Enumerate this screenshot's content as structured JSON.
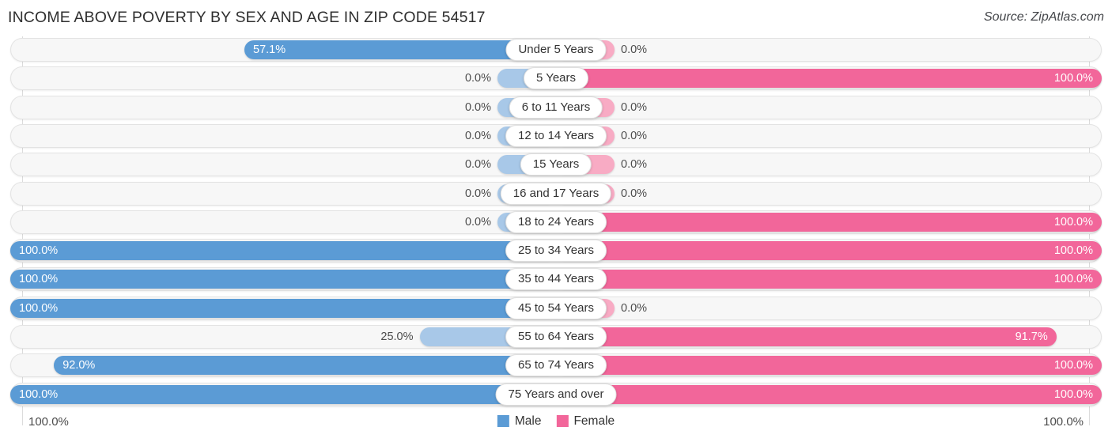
{
  "header": {
    "title": "INCOME ABOVE POVERTY BY SEX AND AGE IN ZIP CODE 54517",
    "source": "Source: ZipAtlas.com"
  },
  "footer": {
    "axis_left": "100.0%",
    "axis_right": "100.0%",
    "legend": [
      {
        "label": "Male",
        "color": "#5b9bd5"
      },
      {
        "label": "Female",
        "color": "#f2669a"
      }
    ]
  },
  "colors": {
    "male_strong": "#5b9bd5",
    "male_light": "#a8c8e8",
    "female_strong": "#f2669a",
    "female_light": "#f8abc4",
    "track": "#f7f7f7",
    "track_border": "#e3e3e3",
    "gridline": "#dcdcdc"
  },
  "chart_data": {
    "type": "bar",
    "title": "INCOME ABOVE POVERTY BY SEX AND AGE IN ZIP CODE 54517",
    "subtitle": "Source: ZipAtlas.com",
    "orientation": "horizontal",
    "layout": "diverging-bidirectional",
    "xlabel": "",
    "ylabel": "",
    "xlim": [
      0,
      100
    ],
    "axis_left_max": "100.0%",
    "axis_right_max": "100.0%",
    "grid": false,
    "legend_position": "bottom-center",
    "categories": [
      "Under 5 Years",
      "5 Years",
      "6 to 11 Years",
      "12 to 14 Years",
      "15 Years",
      "16 and 17 Years",
      "18 to 24 Years",
      "25 to 34 Years",
      "35 to 44 Years",
      "45 to 54 Years",
      "55 to 64 Years",
      "65 to 74 Years",
      "75 Years and over"
    ],
    "series": [
      {
        "name": "Male",
        "color": "#5b9bd5",
        "side": "left",
        "values": [
          57.1,
          0.0,
          0.0,
          0.0,
          0.0,
          0.0,
          0.0,
          100.0,
          100.0,
          100.0,
          25.0,
          92.0,
          100.0
        ],
        "labels": [
          "57.1%",
          "0.0%",
          "0.0%",
          "0.0%",
          "0.0%",
          "0.0%",
          "0.0%",
          "100.0%",
          "100.0%",
          "100.0%",
          "25.0%",
          "92.0%",
          "100.0%"
        ]
      },
      {
        "name": "Female",
        "color": "#f2669a",
        "side": "right",
        "values": [
          0.0,
          100.0,
          0.0,
          0.0,
          0.0,
          0.0,
          100.0,
          100.0,
          100.0,
          0.0,
          91.7,
          100.0,
          100.0
        ],
        "labels": [
          "0.0%",
          "100.0%",
          "0.0%",
          "0.0%",
          "0.0%",
          "0.0%",
          "100.0%",
          "100.0%",
          "100.0%",
          "0.0%",
          "91.7%",
          "100.0%",
          "100.0%"
        ]
      }
    ]
  }
}
